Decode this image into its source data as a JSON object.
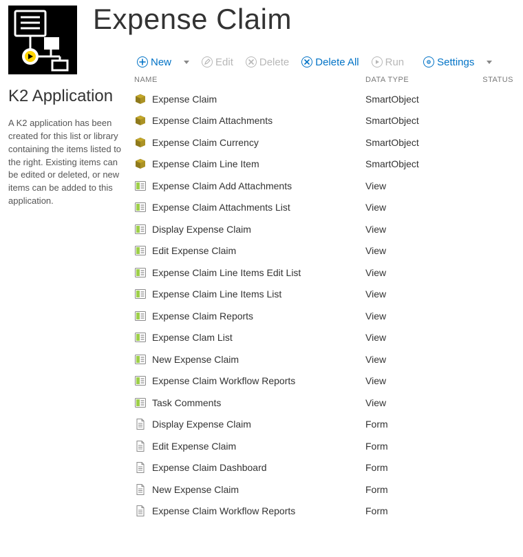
{
  "sidebar": {
    "heading": "K2 Application",
    "description": "A K2 application has been created for this list or library containing the items listed to the right. Existing items can be edited or deleted, or new items can be added to this application."
  },
  "title": "Expense Claim",
  "toolbar": {
    "new_label": "New",
    "edit_label": "Edit",
    "delete_label": "Delete",
    "delete_all_label": "Delete All",
    "run_label": "Run",
    "settings_label": "Settings"
  },
  "columns": {
    "name": "NAME",
    "data_type": "DATA TYPE",
    "status": "STATUS"
  },
  "rows": [
    {
      "name": "Expense Claim",
      "type": "SmartObject",
      "status": "",
      "icon": "smartobject"
    },
    {
      "name": "Expense Claim Attachments",
      "type": "SmartObject",
      "status": "",
      "icon": "smartobject"
    },
    {
      "name": "Expense Claim Currency",
      "type": "SmartObject",
      "status": "",
      "icon": "smartobject"
    },
    {
      "name": "Expense Claim Line Item",
      "type": "SmartObject",
      "status": "",
      "icon": "smartobject"
    },
    {
      "name": "Expense Claim Add Attachments",
      "type": "View",
      "status": "",
      "icon": "view"
    },
    {
      "name": "Expense Claim Attachments List",
      "type": "View",
      "status": "",
      "icon": "view"
    },
    {
      "name": "Display Expense Claim",
      "type": "View",
      "status": "",
      "icon": "view"
    },
    {
      "name": "Edit Expense Claim",
      "type": "View",
      "status": "",
      "icon": "view"
    },
    {
      "name": "Expense Claim Line Items Edit List",
      "type": "View",
      "status": "",
      "icon": "view"
    },
    {
      "name": "Expense Claim Line Items List",
      "type": "View",
      "status": "",
      "icon": "view"
    },
    {
      "name": "Expense Claim Reports",
      "type": "View",
      "status": "",
      "icon": "view"
    },
    {
      "name": "Expense Clam List",
      "type": "View",
      "status": "",
      "icon": "view"
    },
    {
      "name": "New Expense Claim",
      "type": "View",
      "status": "",
      "icon": "view"
    },
    {
      "name": "Expense Claim Workflow Reports",
      "type": "View",
      "status": "",
      "icon": "view"
    },
    {
      "name": "Task Comments",
      "type": "View",
      "status": "",
      "icon": "view"
    },
    {
      "name": "Display Expense Claim",
      "type": "Form",
      "status": "",
      "icon": "form"
    },
    {
      "name": "Edit Expense Claim",
      "type": "Form",
      "status": "",
      "icon": "form"
    },
    {
      "name": "Expense Claim Dashboard",
      "type": "Form",
      "status": "",
      "icon": "form"
    },
    {
      "name": "New Expense Claim",
      "type": "Form",
      "status": "",
      "icon": "form"
    },
    {
      "name": "Expense Claim Workflow Reports",
      "type": "Form",
      "status": "",
      "icon": "form"
    }
  ],
  "icons": {
    "smartobject": "smartobject-icon",
    "view": "view-icon",
    "form": "form-icon"
  }
}
